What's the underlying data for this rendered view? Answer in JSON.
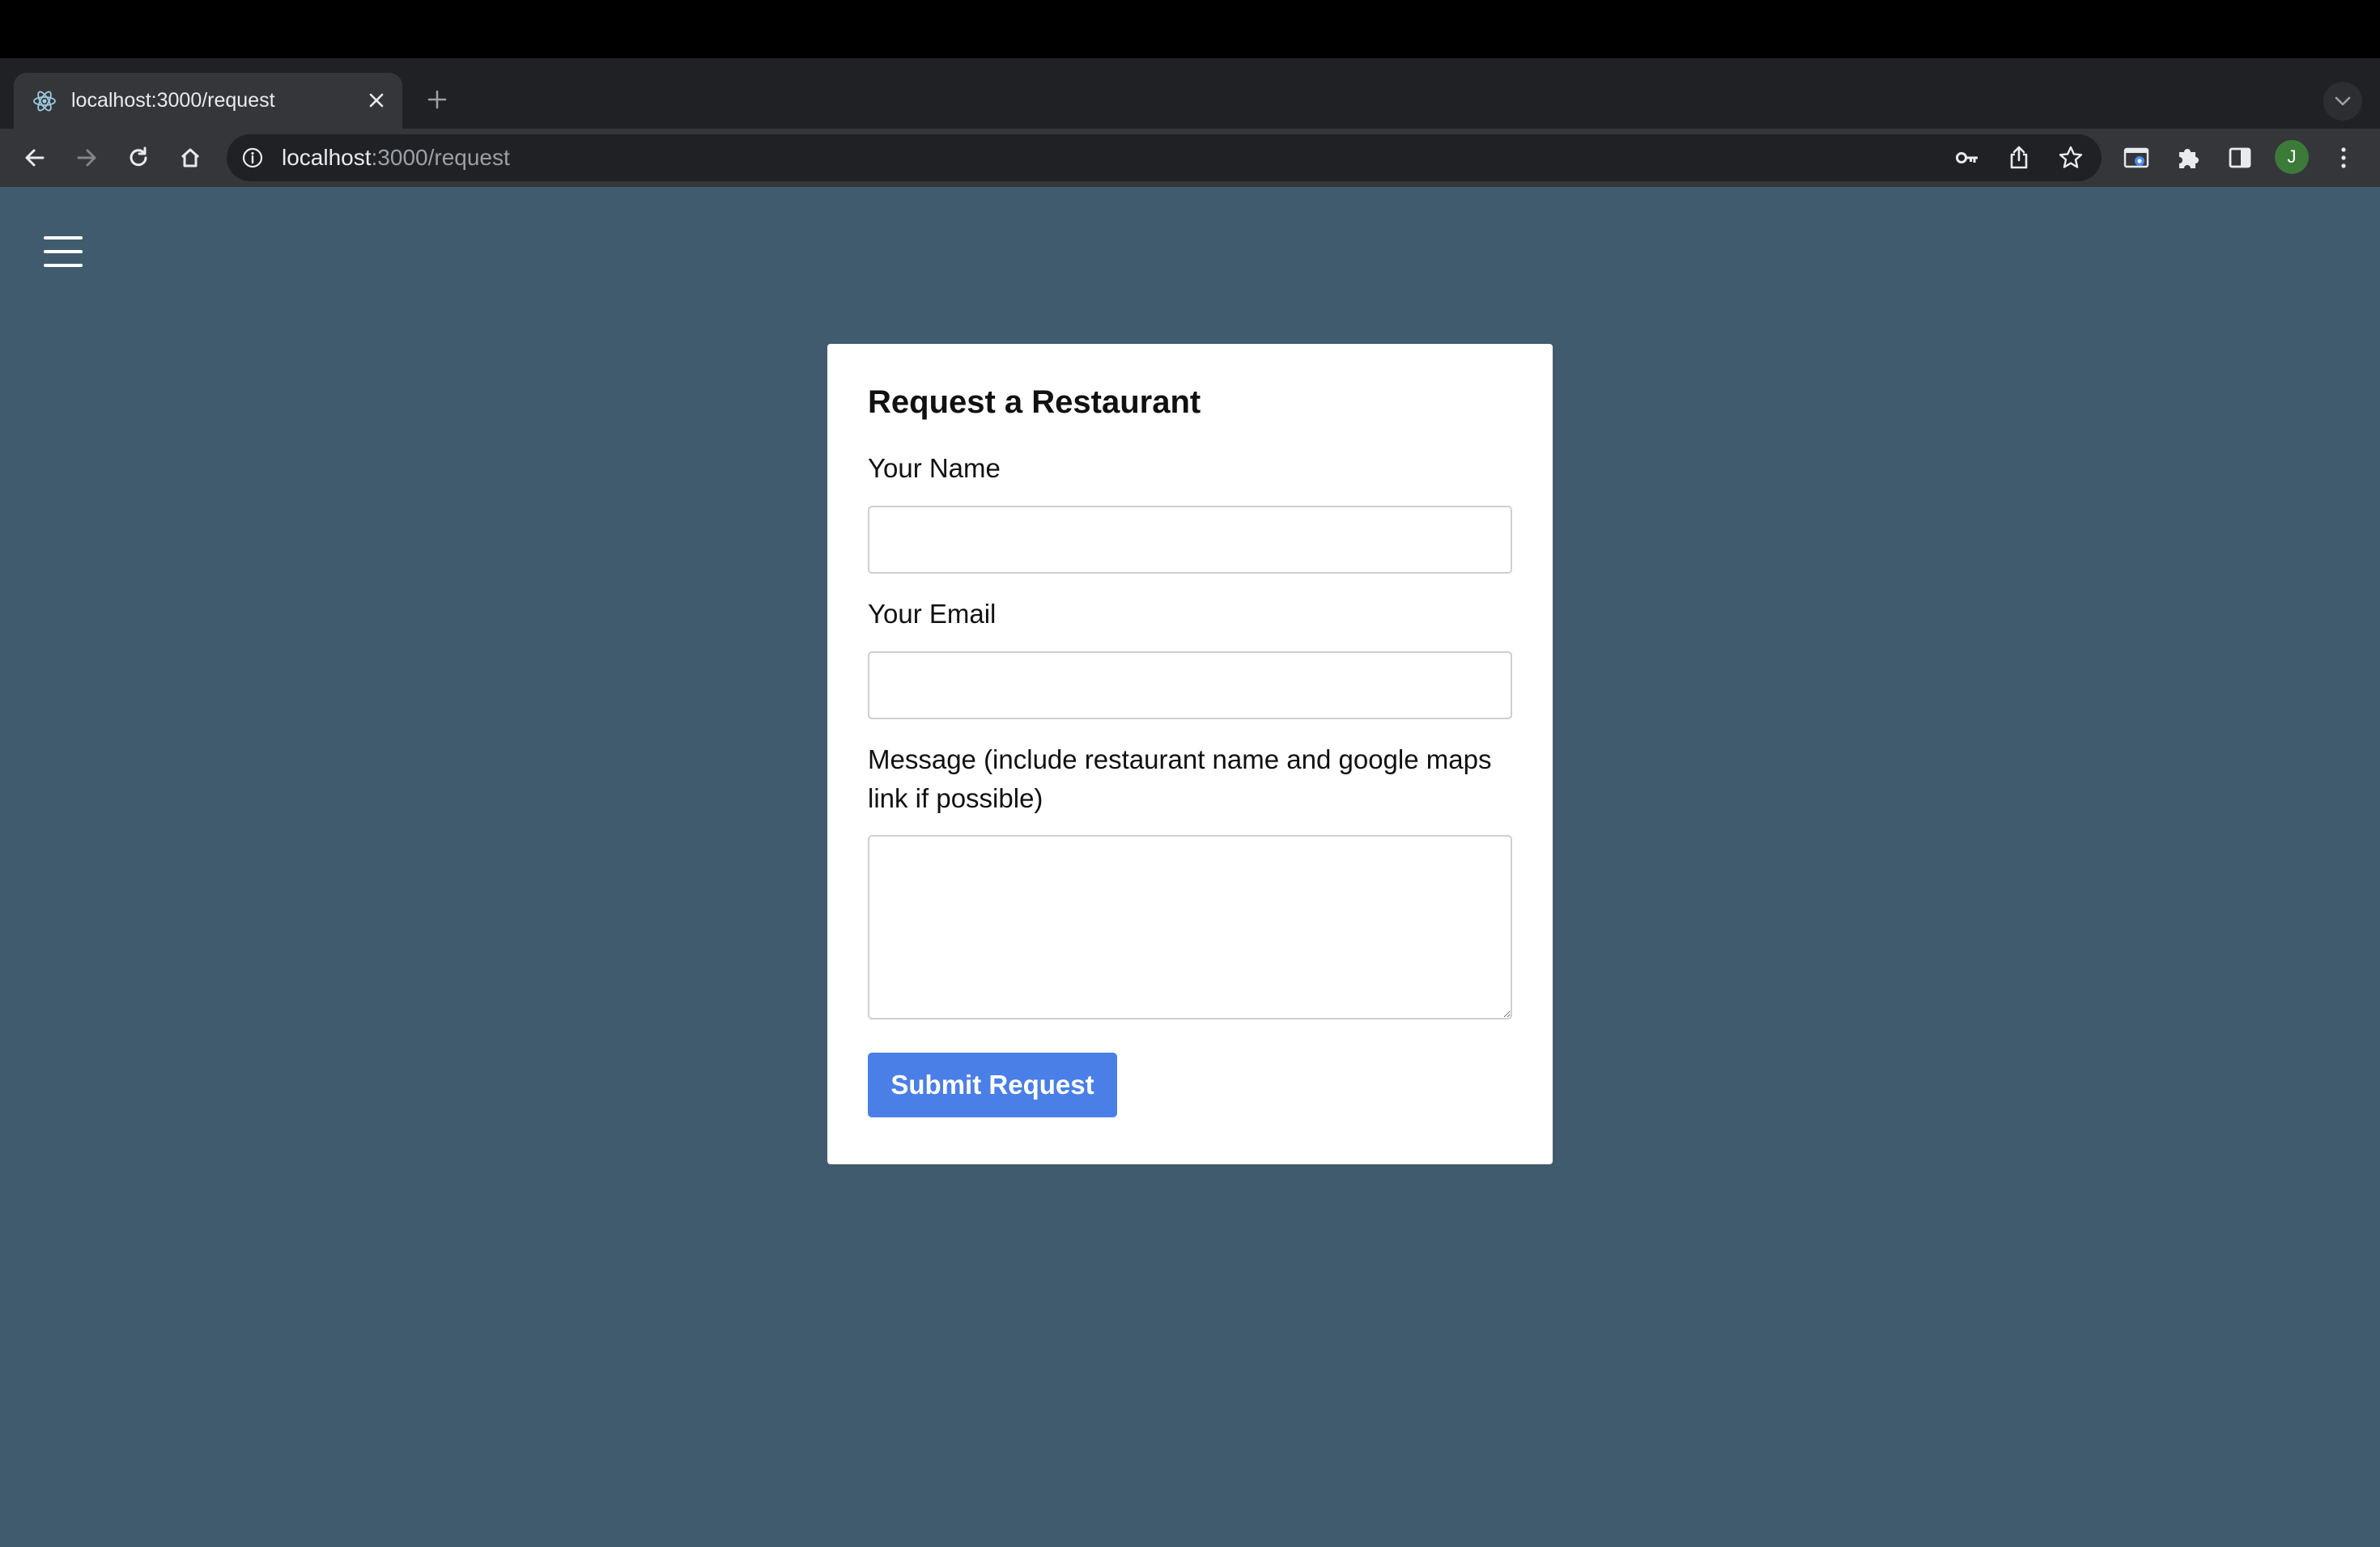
{
  "browser": {
    "tab": {
      "title": "localhost:3000/request",
      "favicon": "react-icon"
    },
    "address": {
      "host": "localhost",
      "path": ":3000/request"
    },
    "profile_initial": "J"
  },
  "form": {
    "title": "Request a Restaurant",
    "name_label": "Your Name",
    "name_value": "",
    "email_label": "Your Email",
    "email_value": "",
    "message_label": "Message (include restaurant name and google maps link if possible)",
    "message_value": "",
    "submit_label": "Submit Request"
  },
  "colors": {
    "page_background": "#415b6e",
    "card_background": "#ffffff",
    "submit_button": "#4a7fe8"
  }
}
